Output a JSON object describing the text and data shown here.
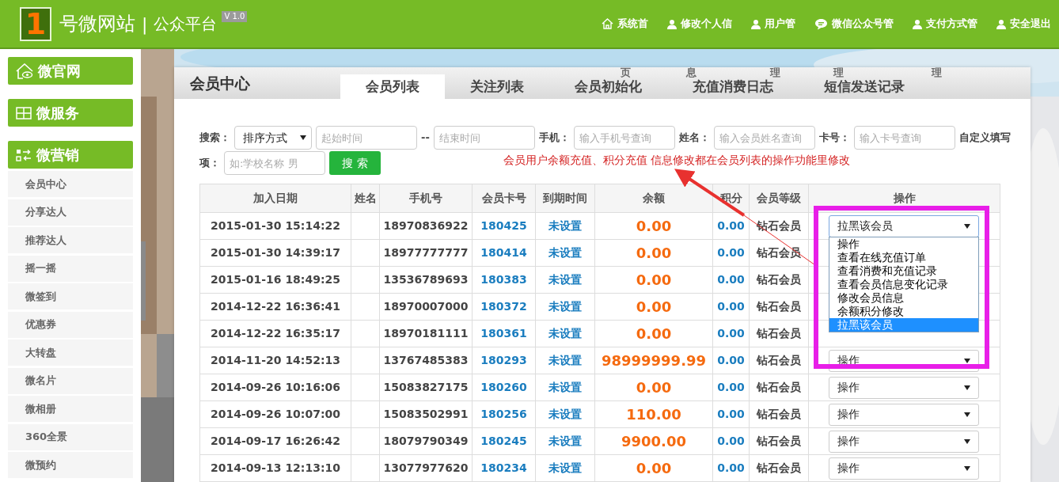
{
  "header": {
    "logo_digit": "1",
    "brand": "号微网站",
    "separator": "|",
    "subtitle": "公众平台",
    "version": "V 1.0",
    "nav": [
      {
        "label": "系统首",
        "overflow": "页"
      },
      {
        "label": "修改个人信",
        "overflow": "息"
      },
      {
        "label": "用户管",
        "overflow": "理"
      },
      {
        "label": "微信公众号管",
        "overflow": "理"
      },
      {
        "label": "支付方式管",
        "overflow": "理"
      },
      {
        "label": "安全退出"
      }
    ]
  },
  "sidebar": {
    "groups": [
      {
        "label": "微官网"
      },
      {
        "label": "微服务"
      },
      {
        "label": "微营销",
        "items": [
          "会员中心",
          "分享达人",
          "推荐达人",
          "摇一摇",
          "微签到",
          "优惠券",
          "大转盘",
          "微名片",
          "微相册",
          "360全景",
          "微预约"
        ]
      }
    ]
  },
  "panel": {
    "title": "会员中心",
    "tabs": [
      {
        "label": "会员列表",
        "selected": true
      },
      {
        "label": "关注列表",
        "selected": false
      },
      {
        "label": "会员初始化",
        "selected": false
      },
      {
        "label": "充值消费日志",
        "selected": false
      },
      {
        "label": "短信发送记录",
        "selected": false
      }
    ],
    "filter_rows": [
      [
        {
          "kind": "label",
          "text": "搜索："
        },
        {
          "kind": "select",
          "value": "排序方式"
        },
        {
          "kind": "input",
          "placeholder": "起始时间"
        },
        {
          "kind": "text",
          "text": "--"
        },
        {
          "kind": "input",
          "placeholder": "结束时间"
        },
        {
          "kind": "label",
          "text": "手机："
        },
        {
          "kind": "input",
          "placeholder": "输入手机号查询"
        },
        {
          "kind": "label",
          "text": "姓名："
        },
        {
          "kind": "input",
          "placeholder": "输入会员姓名查询"
        },
        {
          "kind": "label",
          "text": "卡号："
        },
        {
          "kind": "input",
          "placeholder": "输入卡号查询"
        },
        {
          "kind": "label",
          "text": "自定义填写"
        }
      ],
      [
        {
          "kind": "label",
          "text": "项："
        },
        {
          "kind": "input",
          "placeholder": "如:学校名称 男"
        },
        {
          "kind": "button",
          "text": "搜 索"
        },
        {
          "kind": "note",
          "text": "会员用户余额充值、积分充值 信息修改都在会员列表的操作功能里修改"
        }
      ]
    ],
    "table": {
      "columns": [
        "加入日期",
        "姓名",
        "手机号",
        "会员卡号",
        "到期时间",
        "余额",
        "积分",
        "会员等级",
        "操作"
      ],
      "rows": [
        {
          "date": "2015-01-30 15:14:22",
          "phone": "18970836922",
          "card": "180425",
          "expiry": "未设置",
          "balance": "0.00",
          "points": "0.00",
          "level": "钻石会员",
          "action": {
            "value": "拉黑该会员",
            "focused": true,
            "options": [
              {
                "label": "操作",
                "selected": false
              },
              {
                "label": "查看在线充值订单",
                "selected": false
              },
              {
                "label": "查看消费和充值记录",
                "selected": false
              },
              {
                "label": "查看会员信息变化记录",
                "selected": false
              },
              {
                "label": "修改会员信息",
                "selected": false
              },
              {
                "label": "余额积分修改",
                "selected": false
              },
              {
                "label": "拉黑该会员",
                "selected": true
              }
            ]
          }
        },
        {
          "date": "2015-01-30 14:39:17",
          "phone": "18977777777",
          "card": "180414",
          "expiry": "未设置",
          "balance": "0.00",
          "points": "0.00",
          "level": "钻石会员"
        },
        {
          "date": "2015-01-16 18:49:25",
          "phone": "13536789693",
          "card": "180383",
          "expiry": "未设置",
          "balance": "0.00",
          "points": "0.00",
          "level": "钻石会员"
        },
        {
          "date": "2014-12-22 16:36:41",
          "phone": "18970007000",
          "card": "180372",
          "expiry": "未设置",
          "balance": "0.00",
          "points": "0.00",
          "level": "钻石会员"
        },
        {
          "date": "2014-12-22 16:35:17",
          "phone": "18970181111",
          "card": "180361",
          "expiry": "未设置",
          "balance": "0.00",
          "points": "0.00",
          "level": "钻石会员"
        },
        {
          "date": "2014-11-20 14:52:13",
          "phone": "13767485383",
          "card": "180293",
          "expiry": "未设置",
          "balance": "98999999.99",
          "points": "0.00",
          "level": "钻石会员",
          "action": {
            "value": "操作",
            "focused": false
          }
        },
        {
          "date": "2014-09-26 10:16:06",
          "phone": "15083827175",
          "card": "180260",
          "expiry": "未设置",
          "balance": "0.00",
          "points": "0.00",
          "level": "钻石会员",
          "action": {
            "value": "操作",
            "focused": false
          }
        },
        {
          "date": "2014-09-26 10:07:00",
          "phone": "15083502991",
          "card": "180256",
          "expiry": "未设置",
          "balance": "110.00",
          "points": "0.00",
          "level": "钻石会员",
          "action": {
            "value": "操作",
            "focused": false
          }
        },
        {
          "date": "2014-09-17 16:26:42",
          "phone": "18079790349",
          "card": "180245",
          "expiry": "未设置",
          "balance": "9900.00",
          "points": "0.00",
          "level": "钻石会员",
          "action": {
            "value": "操作",
            "focused": false
          }
        },
        {
          "date": "2014-09-13 12:13:10",
          "phone": "13077977620",
          "card": "180234",
          "expiry": "未设置",
          "balance": "0.00",
          "points": "0.00",
          "level": "钻石会员",
          "action": {
            "value": "操作",
            "focused": false
          }
        }
      ]
    }
  },
  "annotation": {
    "arrow": true,
    "highlight": true
  }
}
